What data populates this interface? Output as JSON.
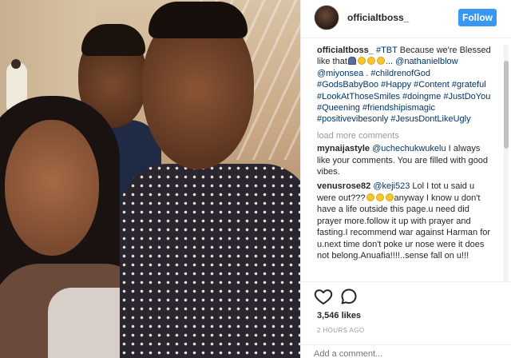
{
  "post": {
    "username": "officialtboss_",
    "follow_label": "Follow",
    "caption": {
      "user": "officialtboss_",
      "text_parts": [
        {
          "t": " "
        },
        {
          "t": "#TBT",
          "link": true
        },
        {
          "t": " Because we're Blessed like that"
        },
        {
          "emoji": "person"
        },
        {
          "emoji": "smile"
        },
        {
          "emoji": "smile"
        },
        {
          "emoji": "smile"
        },
        {
          "t": "... "
        },
        {
          "t": "@nathanielblow",
          "link": true
        },
        {
          "t": " "
        },
        {
          "t": "@miyonsea",
          "link": true
        },
        {
          "t": " . "
        },
        {
          "t": "#childrenofGod",
          "link": true
        },
        {
          "t": " "
        },
        {
          "t": "#GodsBabyBoo",
          "link": true
        },
        {
          "t": " "
        },
        {
          "t": "#Happy",
          "link": true
        },
        {
          "t": " "
        },
        {
          "t": "#Content",
          "link": true
        },
        {
          "t": " "
        },
        {
          "t": "#grateful",
          "link": true
        },
        {
          "t": " "
        },
        {
          "t": "#LookAtThoseSmiles",
          "link": true
        },
        {
          "t": " "
        },
        {
          "t": "#doingme",
          "link": true
        },
        {
          "t": " "
        },
        {
          "t": "#JustDoYou",
          "link": true
        },
        {
          "t": " "
        },
        {
          "t": "#Queening",
          "link": true
        },
        {
          "t": " "
        },
        {
          "t": "#friendshipismagic",
          "link": true
        },
        {
          "t": " "
        },
        {
          "t": "#positivevibesonly",
          "link": true
        },
        {
          "t": " "
        },
        {
          "t": "#JesusDontLikeUgly",
          "link": true
        }
      ]
    },
    "load_more": "load more comments",
    "comments": [
      {
        "user": "mynaijastyle",
        "text_parts": [
          {
            "t": " "
          },
          {
            "t": "@uchechukwukelu",
            "link": true
          },
          {
            "t": " I always like your comments. You are filled with good vibes."
          }
        ]
      },
      {
        "user": "venusrose82",
        "text_parts": [
          {
            "t": " "
          },
          {
            "t": "@keji523",
            "link": true
          },
          {
            "t": " Lol I tot u said u were out???"
          },
          {
            "emoji": "smile"
          },
          {
            "emoji": "smile"
          },
          {
            "emoji": "smile"
          },
          {
            "t": "anyway I know u don't have a life outside this page.u need did prayer more.follow it up with prayer and fasting.I recommend war against Harman for u.next time don't poke ur nose were it does not belong.Anuafia!!!!..sense fall on u!!!"
          }
        ]
      }
    ],
    "likes": "3,546 likes",
    "timestamp": "2 HOURS AGO",
    "add_comment_placeholder": "Add a comment..."
  },
  "colors": {
    "follow_button": "#3897f0",
    "link": "#003569",
    "muted": "#999999"
  },
  "icons": [
    "heart-icon",
    "comment-icon"
  ]
}
